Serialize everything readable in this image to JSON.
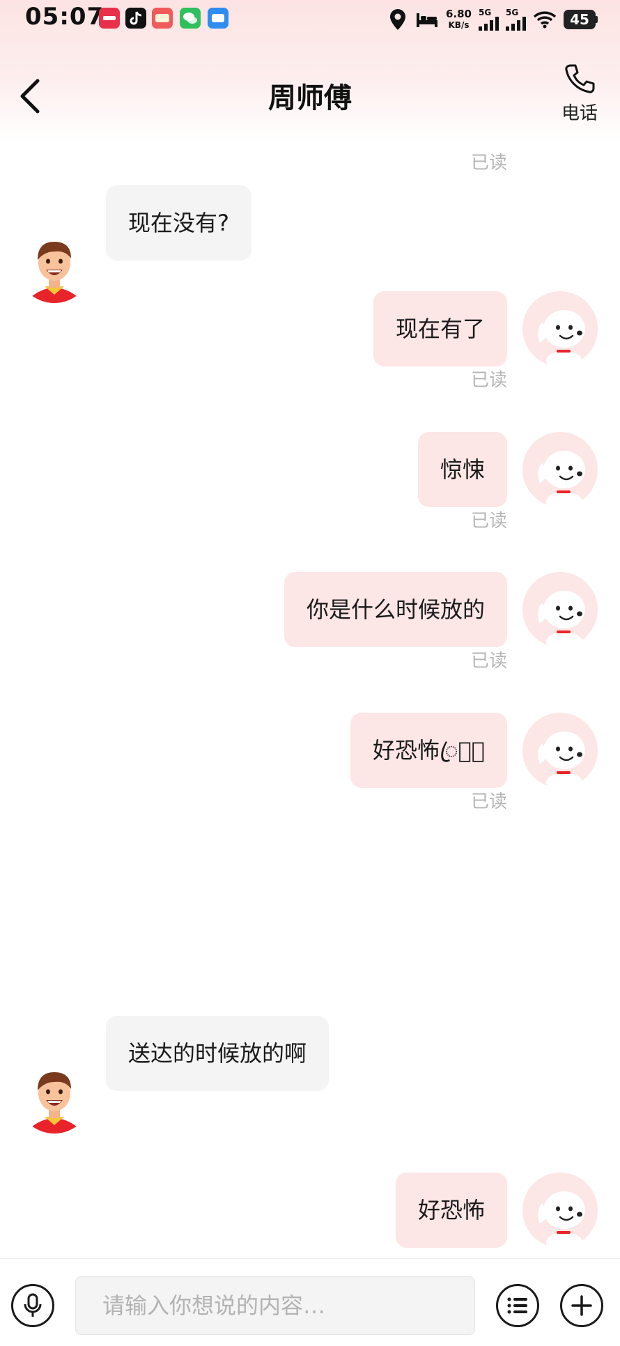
{
  "status_bar": {
    "time": "05:07",
    "net_speed_value": "6.80",
    "net_speed_unit": "KB/s",
    "sim1_label": "5G",
    "sim2_label": "5G",
    "battery": "45",
    "app_icons": [
      "xiaohongshu-icon",
      "douyin-icon",
      "game-icon",
      "wechat-icon",
      "chat-app-icon"
    ]
  },
  "header": {
    "title": "周师傅",
    "call_label": "电话"
  },
  "messages": [
    {
      "side": "me",
      "text": "",
      "read_label": "已读"
    },
    {
      "side": "other",
      "text": "现在没有?"
    },
    {
      "side": "me",
      "text": "现在有了",
      "read_label": "已读"
    },
    {
      "side": "me",
      "text": "惊悚",
      "read_label": "已读"
    },
    {
      "side": "me",
      "text": "你是什么时候放的",
      "read_label": "已读"
    },
    {
      "side": "me",
      "text": "好恐怖ꦿ⌓ꦿ",
      "read_label": "已读"
    },
    {
      "side": "other",
      "text": "送达的时候放的啊"
    },
    {
      "side": "me",
      "text": "好恐怖"
    }
  ],
  "input": {
    "placeholder": "请输入你想说的内容…",
    "value": ""
  },
  "colors": {
    "my_bubble": "#fde6e6",
    "other_bubble": "#f4f4f4",
    "read_text": "#b5b5b5",
    "header_gradient_top": "#fde3e3"
  }
}
